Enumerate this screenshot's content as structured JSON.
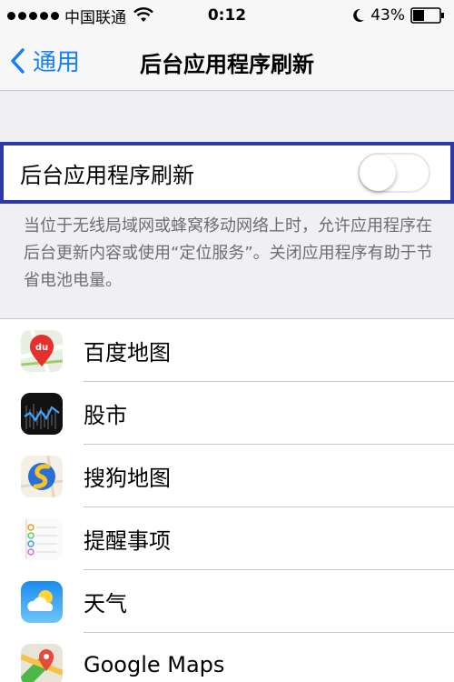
{
  "status_bar": {
    "carrier": "中国联通",
    "time": "0:12",
    "battery": "43%",
    "battery_level": 0.43
  },
  "nav": {
    "back_label": "通用",
    "title": "后台应用程序刷新"
  },
  "setting": {
    "label": "后台应用程序刷新",
    "enabled": false
  },
  "description": "当位于无线局域网或蜂窝移动网络上时，允许应用程序在后台更新内容或使用“定位服务”。关闭应用程序有助于节省电池电量。",
  "apps": [
    {
      "name": "百度地图",
      "icon": "baidu-map-icon"
    },
    {
      "name": "股市",
      "icon": "stocks-icon"
    },
    {
      "name": "搜狗地图",
      "icon": "sogou-map-icon"
    },
    {
      "name": "提醒事项",
      "icon": "reminders-icon"
    },
    {
      "name": "天气",
      "icon": "weather-icon"
    },
    {
      "name": "Google Maps",
      "icon": "google-maps-icon"
    }
  ],
  "colors": {
    "accent": "#157efb",
    "highlight_border": "#2b3aa8",
    "background": "#efeff4"
  }
}
